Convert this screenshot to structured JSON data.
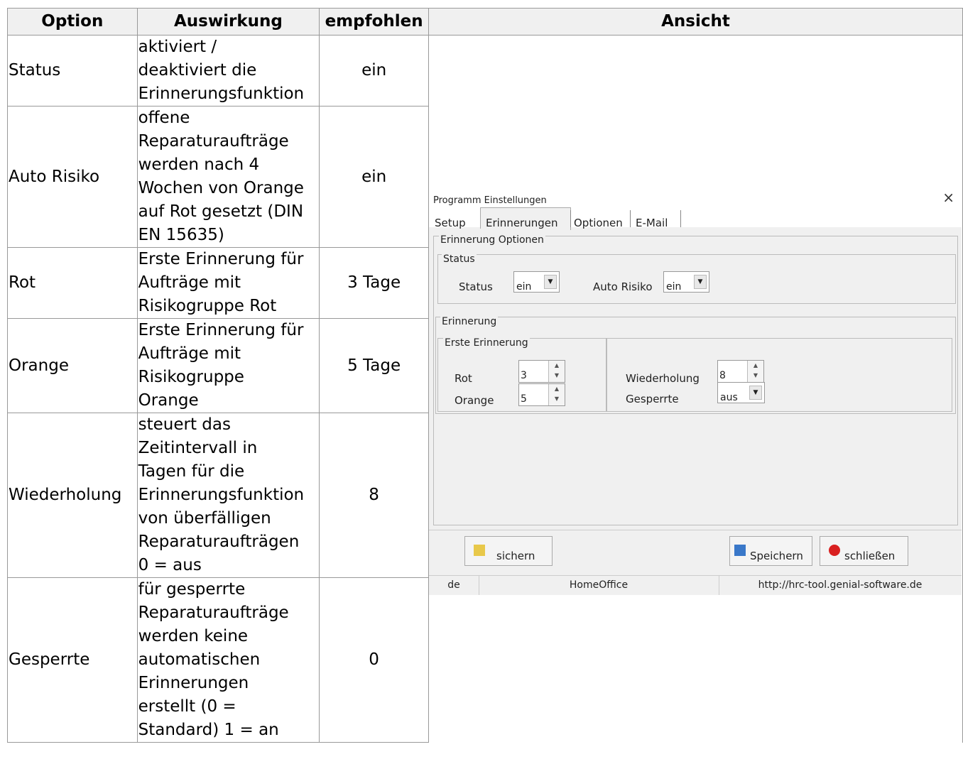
{
  "table": {
    "headers": [
      "Option",
      "Auswirkung",
      "empfohlen",
      "Ansicht"
    ],
    "rows": [
      {
        "option": "Status",
        "effect": "aktiviert /\ndeaktiviert die\nErinnerungsfunktion",
        "recommended": "ein"
      },
      {
        "option": "Auto Risiko",
        "effect": "offene\nReparaturaufträge\nwerden nach 4\nWochen von Orange\nauf Rot gesetzt (DIN\nEN 15635)",
        "recommended": "ein"
      },
      {
        "option": "Rot",
        "effect": "Erste Erinnerung für\nAufträge mit\nRisikogruppe Rot",
        "recommended": "3 Tage"
      },
      {
        "option": "Orange",
        "effect": "Erste Erinnerung für\nAufträge mit\nRisikogruppe\nOrange",
        "recommended": "5 Tage"
      },
      {
        "option": "Wiederholung",
        "effect": "steuert das\nZeitintervall in\nTagen für die\nErinnerungsfunktion\nvon überfälligen\nReparaturaufträgen\n0 = aus",
        "recommended": "8"
      },
      {
        "option": "Gesperrte",
        "effect": "für gesperrte\nReparaturaufträge\nwerden keine\nautomatischen\nErinnerungen\nerstellt (0 =\nStandard) 1 = an",
        "recommended": "0"
      }
    ]
  },
  "dialog": {
    "title": "Programm Einstellungen",
    "close_glyph": "×",
    "tabs": [
      "Setup",
      "Erinnerungen",
      "Optionen",
      "E-Mail"
    ],
    "active_tab": "Erinnerungen",
    "group_main": "Erinnerung Optionen",
    "group_status": "Status",
    "status_label": "Status",
    "status_value": "ein",
    "auto_risiko_label": "Auto Risiko",
    "auto_risiko_value": "ein",
    "group_erinnerung": "Erinnerung",
    "group_erste": "Erste Erinnerung",
    "rot_label": "Rot",
    "rot_value": "3",
    "orange_label": "Orange",
    "orange_value": "5",
    "wiederholung_label": "Wiederholung",
    "wiederholung_value": "8",
    "gesperrte_label": "Gesperrte",
    "gesperrte_value": "aus",
    "btn_sichern": "sichern",
    "btn_speichern": "Speichern",
    "btn_schliessen": "schließen",
    "status_lang": "de",
    "status_profile": "HomeOffice",
    "status_url": "http://hrc-tool.genial-software.de",
    "colors": {
      "tab_bg": "#f0f0f0",
      "dialog_bg": "#f0f0f0",
      "close_icon": "#d92020",
      "save_icon": "#3a78c9",
      "sichern_icon": "#e8c84a"
    }
  }
}
